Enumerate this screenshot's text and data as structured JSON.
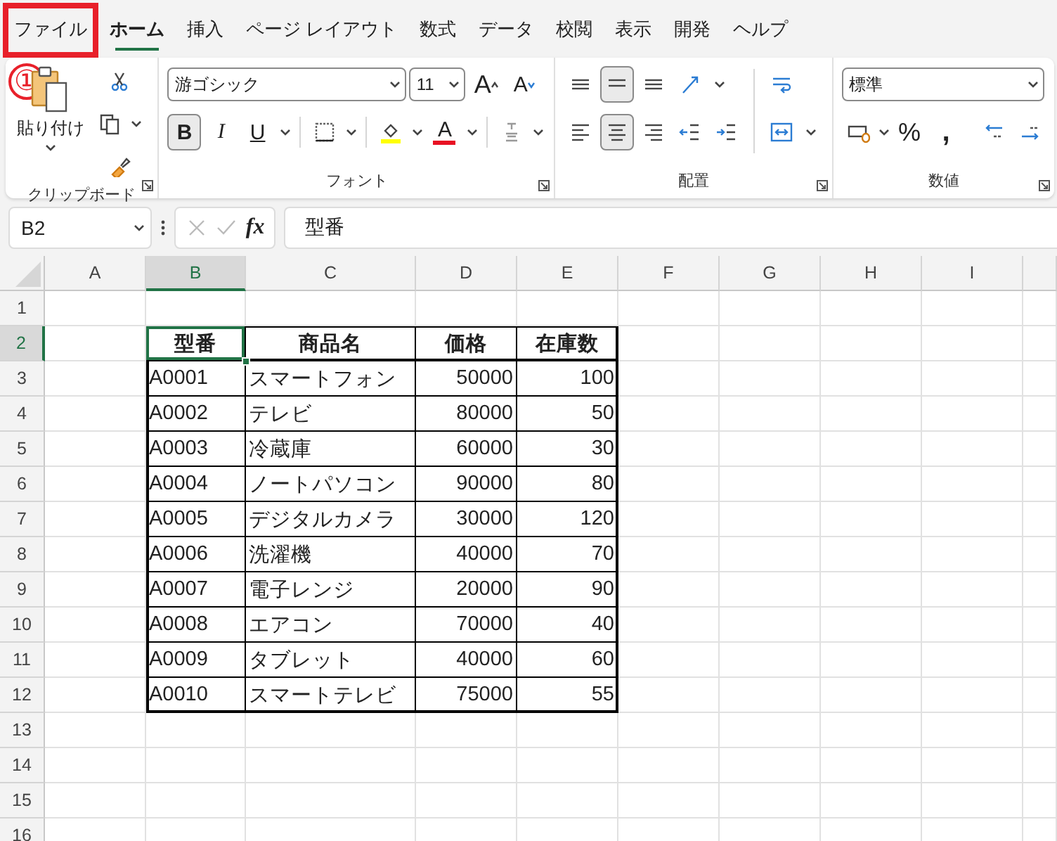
{
  "tabs": [
    {
      "label": "ファイル",
      "selected": false,
      "highlighted": true
    },
    {
      "label": "ホーム",
      "selected": true,
      "highlighted": false
    },
    {
      "label": "挿入",
      "selected": false,
      "highlighted": false
    },
    {
      "label": "ページ レイアウト",
      "selected": false,
      "highlighted": false
    },
    {
      "label": "数式",
      "selected": false,
      "highlighted": false
    },
    {
      "label": "データ",
      "selected": false,
      "highlighted": false
    },
    {
      "label": "校閲",
      "selected": false,
      "highlighted": false
    },
    {
      "label": "表示",
      "selected": false,
      "highlighted": false
    },
    {
      "label": "開発",
      "selected": false,
      "highlighted": false
    },
    {
      "label": "ヘルプ",
      "selected": false,
      "highlighted": false
    }
  ],
  "annotation": {
    "label": "①"
  },
  "ribbon": {
    "clipboard": {
      "paste_label": "貼り付け",
      "group_label": "クリップボード"
    },
    "font": {
      "font_name": "游ゴシック",
      "font_size": "11",
      "grow": "A",
      "shrink": "A",
      "bold": {
        "label": "B",
        "selected": true
      },
      "italic": "I",
      "underline": "U",
      "font_color": "A",
      "group_label": "フォント"
    },
    "alignment": {
      "group_label": "配置",
      "vertical": [
        {
          "kind": "top",
          "selected": false
        },
        {
          "kind": "middle",
          "selected": true
        },
        {
          "kind": "bottom",
          "selected": false
        }
      ],
      "horizontal": [
        {
          "kind": "left",
          "selected": false
        },
        {
          "kind": "center",
          "selected": true
        },
        {
          "kind": "right",
          "selected": false
        }
      ]
    },
    "number": {
      "format": "標準",
      "percent": "%",
      "comma": ",",
      "group_label": "数値"
    }
  },
  "formula_bar": {
    "name_box": "B2",
    "fx": "fx",
    "value": "型番"
  },
  "sheet": {
    "columns": [
      {
        "label": "A",
        "selected": false
      },
      {
        "label": "B",
        "selected": true
      },
      {
        "label": "C",
        "selected": false
      },
      {
        "label": "D",
        "selected": false
      },
      {
        "label": "E",
        "selected": false
      },
      {
        "label": "F",
        "selected": false
      },
      {
        "label": "G",
        "selected": false
      },
      {
        "label": "H",
        "selected": false
      },
      {
        "label": "I",
        "selected": false
      }
    ],
    "rows": [
      {
        "label": "1",
        "selected": false,
        "cells": {}
      },
      {
        "label": "2",
        "selected": true,
        "cells": {
          "B": {
            "text": "型番",
            "kind": "header"
          },
          "C": {
            "text": "商品名",
            "kind": "header"
          },
          "D": {
            "text": "価格",
            "kind": "header"
          },
          "E": {
            "text": "在庫数",
            "kind": "header"
          }
        }
      },
      {
        "label": "3",
        "selected": false,
        "cells": {
          "B": {
            "text": "A0001",
            "kind": "text"
          },
          "C": {
            "text": "スマートフォン",
            "kind": "text"
          },
          "D": {
            "text": "50000",
            "kind": "number"
          },
          "E": {
            "text": "100",
            "kind": "number"
          }
        }
      },
      {
        "label": "4",
        "selected": false,
        "cells": {
          "B": {
            "text": "A0002",
            "kind": "text"
          },
          "C": {
            "text": "テレビ",
            "kind": "text"
          },
          "D": {
            "text": "80000",
            "kind": "number"
          },
          "E": {
            "text": "50",
            "kind": "number"
          }
        }
      },
      {
        "label": "5",
        "selected": false,
        "cells": {
          "B": {
            "text": "A0003",
            "kind": "text"
          },
          "C": {
            "text": "冷蔵庫",
            "kind": "text"
          },
          "D": {
            "text": "60000",
            "kind": "number"
          },
          "E": {
            "text": "30",
            "kind": "number"
          }
        }
      },
      {
        "label": "6",
        "selected": false,
        "cells": {
          "B": {
            "text": "A0004",
            "kind": "text"
          },
          "C": {
            "text": "ノートパソコン",
            "kind": "text"
          },
          "D": {
            "text": "90000",
            "kind": "number"
          },
          "E": {
            "text": "80",
            "kind": "number"
          }
        }
      },
      {
        "label": "7",
        "selected": false,
        "cells": {
          "B": {
            "text": "A0005",
            "kind": "text"
          },
          "C": {
            "text": "デジタルカメラ",
            "kind": "text"
          },
          "D": {
            "text": "30000",
            "kind": "number"
          },
          "E": {
            "text": "120",
            "kind": "number"
          }
        }
      },
      {
        "label": "8",
        "selected": false,
        "cells": {
          "B": {
            "text": "A0006",
            "kind": "text"
          },
          "C": {
            "text": "洗濯機",
            "kind": "text"
          },
          "D": {
            "text": "40000",
            "kind": "number"
          },
          "E": {
            "text": "70",
            "kind": "number"
          }
        }
      },
      {
        "label": "9",
        "selected": false,
        "cells": {
          "B": {
            "text": "A0007",
            "kind": "text"
          },
          "C": {
            "text": "電子レンジ",
            "kind": "text"
          },
          "D": {
            "text": "20000",
            "kind": "number"
          },
          "E": {
            "text": "90",
            "kind": "number"
          }
        }
      },
      {
        "label": "10",
        "selected": false,
        "cells": {
          "B": {
            "text": "A0008",
            "kind": "text"
          },
          "C": {
            "text": "エアコン",
            "kind": "text"
          },
          "D": {
            "text": "70000",
            "kind": "number"
          },
          "E": {
            "text": "40",
            "kind": "number"
          }
        }
      },
      {
        "label": "11",
        "selected": false,
        "cells": {
          "B": {
            "text": "A0009",
            "kind": "text"
          },
          "C": {
            "text": "タブレット",
            "kind": "text"
          },
          "D": {
            "text": "40000",
            "kind": "number"
          },
          "E": {
            "text": "60",
            "kind": "number"
          }
        }
      },
      {
        "label": "12",
        "selected": false,
        "cells": {
          "B": {
            "text": "A0010",
            "kind": "text"
          },
          "C": {
            "text": "スマートテレビ",
            "kind": "text"
          },
          "D": {
            "text": "75000",
            "kind": "number"
          },
          "E": {
            "text": "55",
            "kind": "number"
          }
        }
      },
      {
        "label": "13",
        "selected": false,
        "cells": {}
      },
      {
        "label": "14",
        "selected": false,
        "cells": {}
      },
      {
        "label": "15",
        "selected": false,
        "cells": {}
      },
      {
        "label": "16",
        "selected": false,
        "cells": {}
      }
    ]
  }
}
